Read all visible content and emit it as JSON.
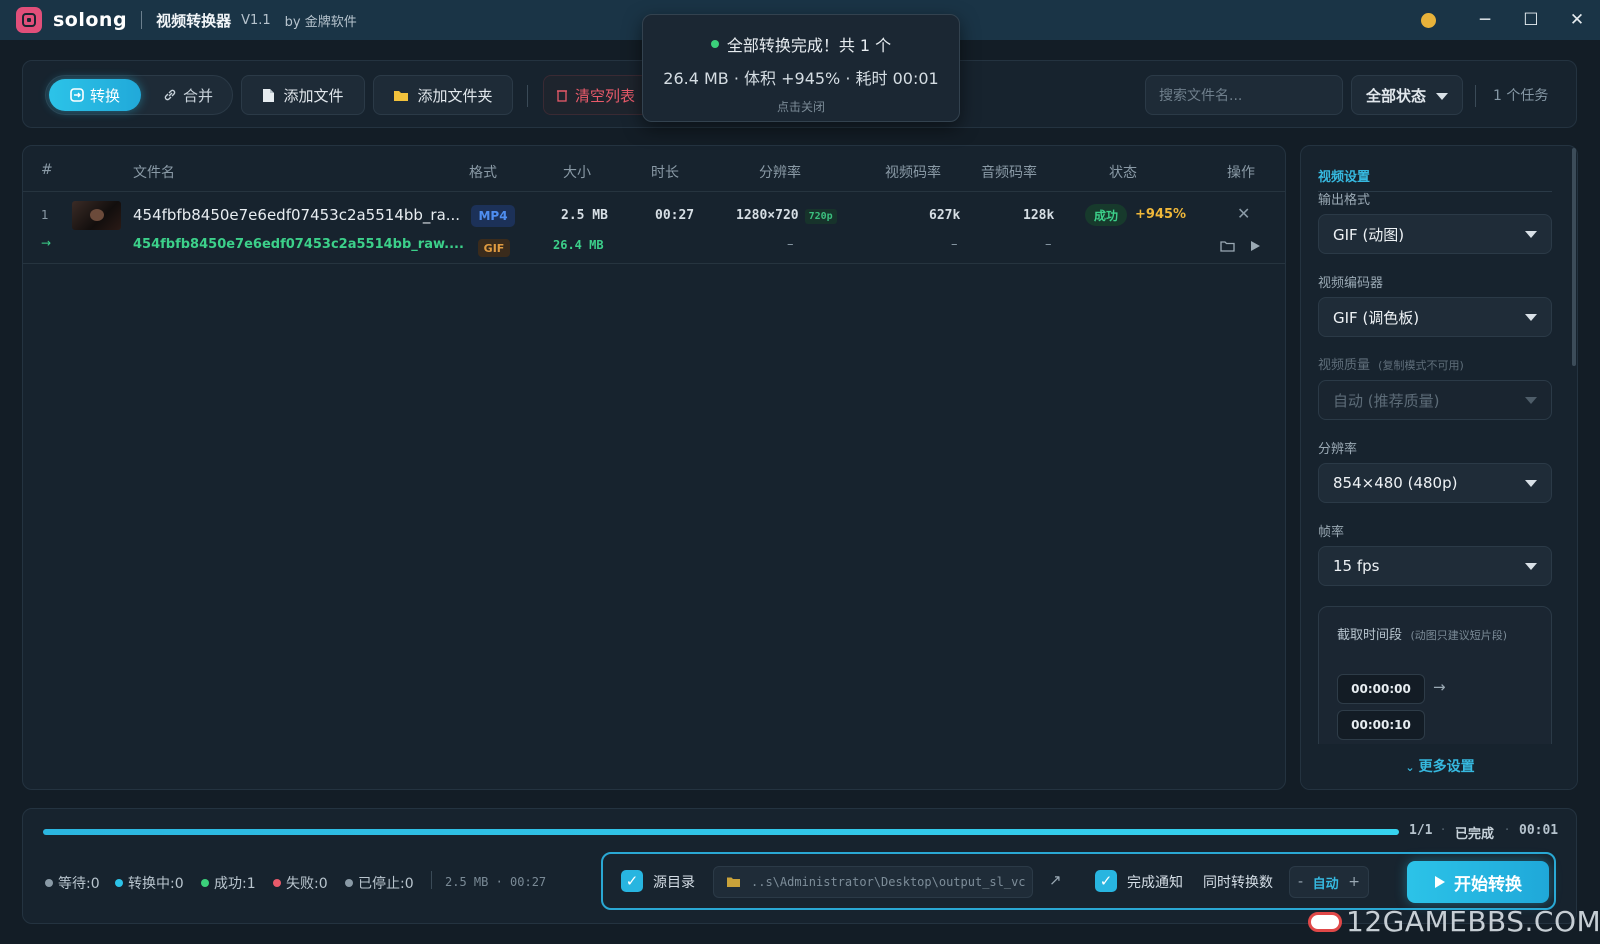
{
  "titlebar": {
    "brand": "solong",
    "app_title": "视频转换器",
    "version": "V1.1",
    "by": "by 金牌软件"
  },
  "toolbar": {
    "mode_convert": "转换",
    "mode_merge": "合并",
    "add_file": "添加文件",
    "add_folder": "添加文件夹",
    "clear_list": "清空列表",
    "search_placeholder": "搜索文件名...",
    "status_filter": "全部状态",
    "task_count": "1 个任务"
  },
  "toast": {
    "line1": "全部转换完成！共 1 个",
    "line2": "26.4 MB · 体积 +945% · 耗时 00:01",
    "line3": "点击关闭",
    "status_color": "#3bd07a"
  },
  "table": {
    "headers": {
      "index": "#",
      "name": "文件名",
      "format": "格式",
      "size": "大小",
      "duration": "时长",
      "resolution": "分辨率",
      "vbitrate": "视频码率",
      "abitrate": "音频码率",
      "status": "状态",
      "action": "操作"
    },
    "rows": [
      {
        "index": "1",
        "name": "454fbfb8450e7e6edf07453c2a5514bb_ra...",
        "format": "MP4",
        "size": "2.5 MB",
        "duration": "00:27",
        "resolution": "1280×720",
        "res_badge": "720p",
        "vbitrate": "627k",
        "abitrate": "128k",
        "status": "成功",
        "change": "+945%",
        "output": {
          "arrow": "→",
          "name": "454fbfb8450e7e6edf07453c2a5514bb_raw....",
          "format": "GIF",
          "size": "26.4 MB",
          "resolution": "–",
          "vbitrate": "–",
          "abitrate": "–"
        }
      }
    ]
  },
  "settings": {
    "section_title": "视频设置",
    "output_format_label": "输出格式",
    "output_format": "GIF (动图)",
    "codec_label": "视频编码器",
    "codec": "GIF (调色板)",
    "quality_label": "视频质量",
    "quality_hint": "(复制模式不可用)",
    "quality": "自动 (推荐质量)",
    "resolution_label": "分辨率",
    "resolution": "854×480 (480p)",
    "fps_label": "帧率",
    "fps": "15 fps",
    "trim_label": "截取时间段",
    "trim_hint": "(动图只建议短片段)",
    "trim_start": "00:00:00",
    "trim_arrow": "→",
    "trim_end": "00:00:10",
    "more": "更多设置"
  },
  "bottom": {
    "progress_fraction": 1.0,
    "progress_count": "1/1",
    "progress_status": "已完成",
    "elapsed": "00:01",
    "stats": {
      "waiting": "等待:0",
      "converting": "转换中:0",
      "success": "成功:1",
      "failed": "失败:0",
      "stopped": "已停止:0"
    },
    "summary": "2.5 MB · 00:27",
    "source_dir_label": "源目录",
    "output_path": "..s\\Administrator\\Desktop\\output_sl_vc",
    "notify_label": "完成通知",
    "concurrency_label": "同时转换数",
    "concurrency_value": "自动",
    "start_button": "开始转换"
  },
  "watermark": "12GAMEBBS.COM",
  "colors": {
    "accent": "#2cc3e8",
    "success": "#3cd08a",
    "danger": "#e85a6a",
    "waiting_dot": "#8a9aa6",
    "converting_dot": "#2cc3e8",
    "success_dot": "#3bd07a",
    "failed_dot": "#e85a6a",
    "stopped_dot": "#8a9aa6"
  }
}
